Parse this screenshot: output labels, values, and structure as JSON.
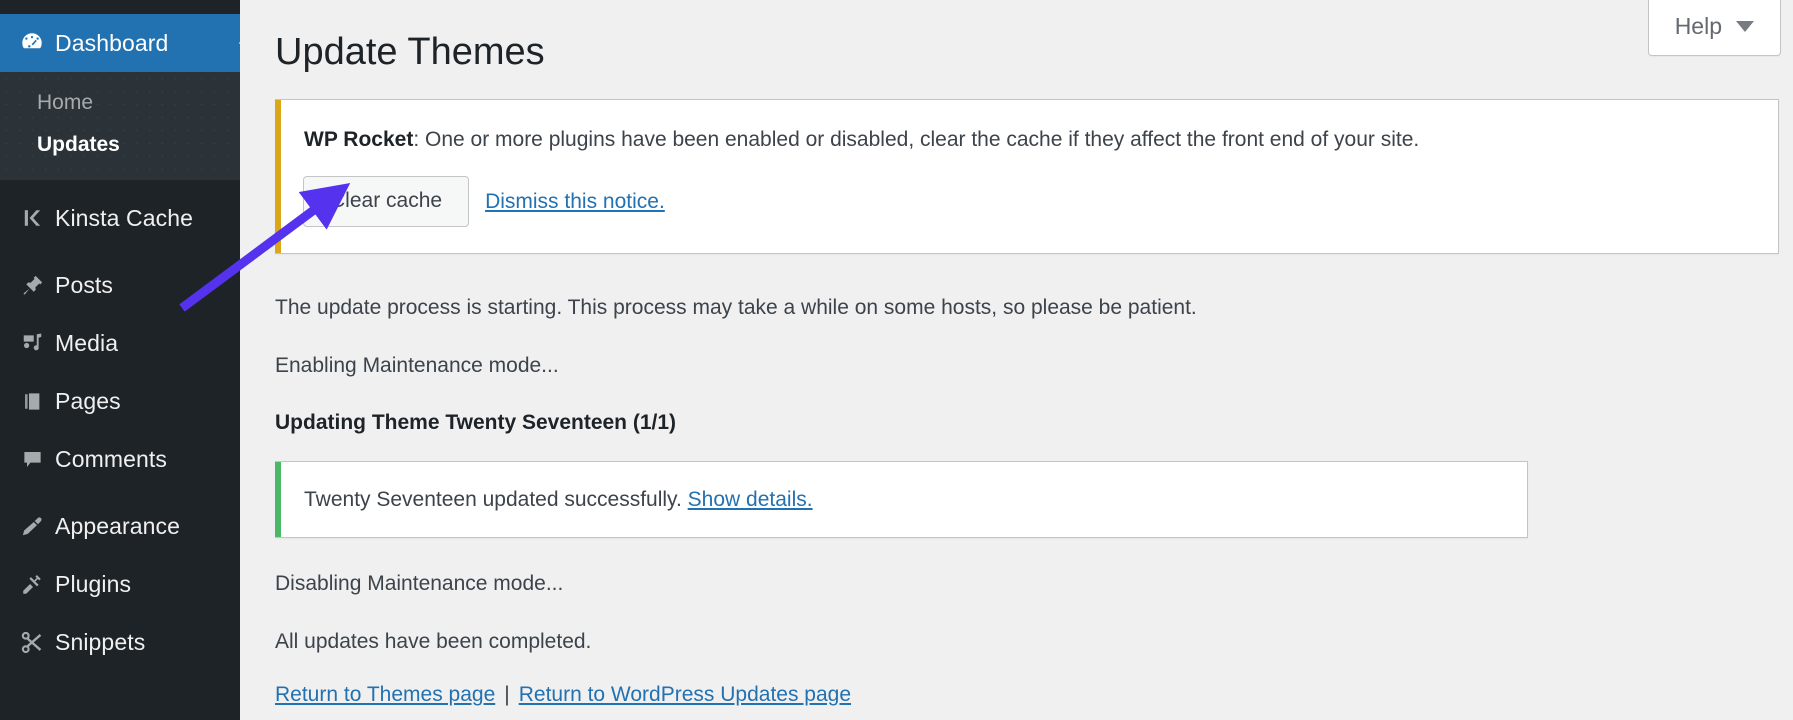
{
  "sidebar": {
    "items": [
      {
        "id": "dashboard",
        "label": "Dashboard",
        "icon": "dashboard-icon",
        "current": true
      },
      {
        "id": "kinsta-cache",
        "label": "Kinsta Cache",
        "icon": "kinsta-k-icon",
        "current": false
      },
      {
        "id": "posts",
        "label": "Posts",
        "icon": "pin-icon",
        "current": false
      },
      {
        "id": "media",
        "label": "Media",
        "icon": "media-icon",
        "current": false
      },
      {
        "id": "pages",
        "label": "Pages",
        "icon": "pages-icon",
        "current": false
      },
      {
        "id": "comments",
        "label": "Comments",
        "icon": "comment-bubble-icon",
        "current": false
      },
      {
        "id": "appearance",
        "label": "Appearance",
        "icon": "paintbrush-icon",
        "current": false
      },
      {
        "id": "plugins",
        "label": "Plugins",
        "icon": "plug-icon",
        "current": false
      },
      {
        "id": "snippets",
        "label": "Snippets",
        "icon": "scissors-icon",
        "current": false
      }
    ],
    "submenu": [
      {
        "id": "home",
        "label": "Home",
        "current": false
      },
      {
        "id": "updates",
        "label": "Updates",
        "current": true
      }
    ]
  },
  "header": {
    "help_label": "Help"
  },
  "page": {
    "title": "Update Themes"
  },
  "notice_warning": {
    "plugin_name": "WP Rocket",
    "separator": ": ",
    "message": "One or more plugins have been enabled or disabled, clear the cache if they affect the front end of your site.",
    "clear_cache_label": "Clear cache",
    "dismiss_label": "Dismiss this notice.",
    "accent_color": "#dba617"
  },
  "update_log": {
    "starting": "The update process is starting. This process may take a while on some hosts, so please be patient.",
    "enabling_maintenance": "Enabling Maintenance mode...",
    "updating_theme": "Updating Theme Twenty Seventeen (1/1)",
    "success_text": "Twenty Seventeen updated successfully. ",
    "show_details_label": "Show details.",
    "disabling_maintenance": "Disabling Maintenance mode...",
    "all_completed": "All updates have been completed.",
    "success_accent_color": "#4ab866"
  },
  "footer_links": {
    "themes_page": "Return to Themes page",
    "separator": "|",
    "updates_page": "Return to WordPress Updates page"
  },
  "annotation": {
    "arrow_color": "#5533ee"
  }
}
